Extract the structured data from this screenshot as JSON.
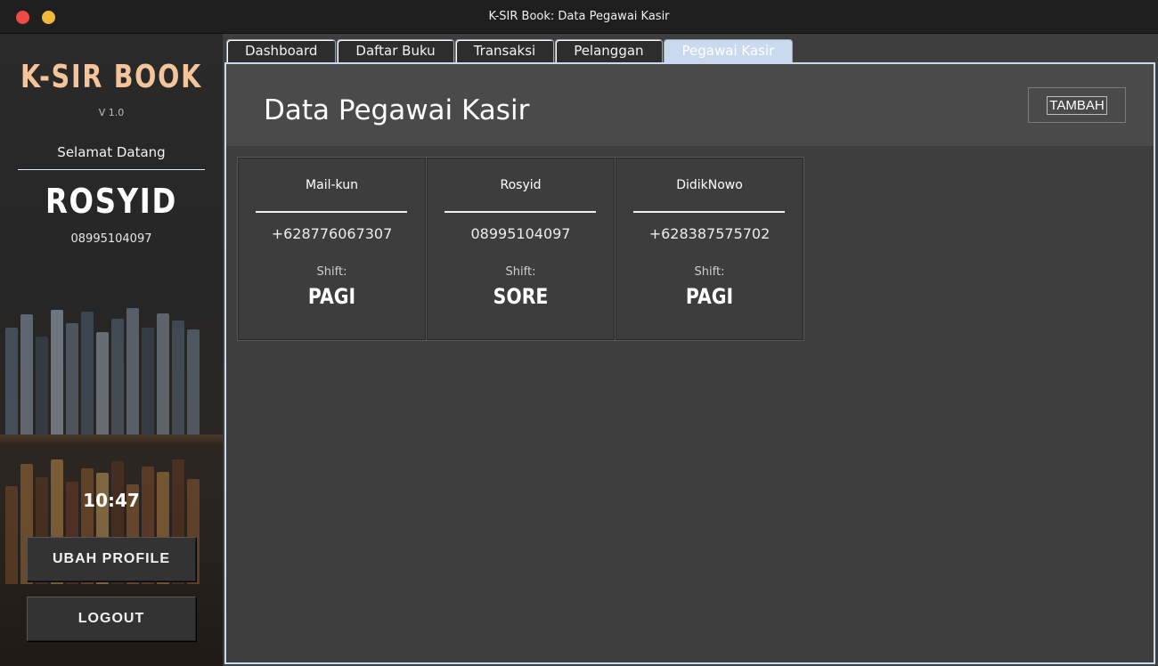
{
  "window": {
    "title": "K-SIR Book: Data Pegawai Kasir",
    "close_color": "#ee4b44",
    "minimize_color": "#f3b73a"
  },
  "sidebar": {
    "brand": "K-SIR BOOK",
    "version": "V 1.0",
    "welcome": "Selamat Datang",
    "user_name": "ROSYID",
    "user_phone": "08995104097",
    "clock": "10:47",
    "profile_button": "UBAH PROFILE",
    "logout_button": "LOGOUT",
    "brand_color": "#f5c49a"
  },
  "tabs": [
    {
      "label": "Dashboard"
    },
    {
      "label": "Daftar Buku"
    },
    {
      "label": "Transaksi"
    },
    {
      "label": "Pelanggan"
    },
    {
      "label": "Pegawai Kasir",
      "active": true
    }
  ],
  "main": {
    "title": "Data Pegawai Kasir",
    "add_button": "TAMBAH",
    "shift_label": "Shift:",
    "employees": [
      {
        "name": "Mail-kun",
        "phone": "+628776067307",
        "shift": "PAGI"
      },
      {
        "name": "Rosyid",
        "phone": "08995104097",
        "shift": "SORE"
      },
      {
        "name": "DidikNowo",
        "phone": "+628387575702",
        "shift": "PAGI"
      }
    ]
  }
}
